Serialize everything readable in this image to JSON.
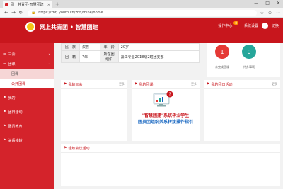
{
  "browser": {
    "tab_title": "网上共青团·智慧团建",
    "tab_close": "×",
    "new_tab": "+",
    "url": "https://zhtj.youth.cn/zhtj/mine/home",
    "window_controls": [
      "—",
      "□",
      "✕"
    ]
  },
  "header": {
    "brand": "网上共青团 • 智慧团建",
    "links": [
      {
        "label": "操作中心",
        "badge": "8"
      },
      {
        "label": "系统设置"
      },
      {
        "label": "切换"
      }
    ]
  },
  "sidebar": {
    "items": [
      {
        "icon": "☰",
        "label": "三会",
        "chev": "⌄"
      },
      {
        "icon": "☰",
        "label": "团课",
        "chev": "⌄"
      },
      {
        "label": "团课",
        "sub": true,
        "active": false
      },
      {
        "label": "公开团课",
        "sub": true,
        "active": true
      },
      {
        "icon": "⚑",
        "label": "我的",
        "chev": ""
      },
      {
        "icon": "⚑",
        "label": "团日活动",
        "chev": ""
      },
      {
        "icon": "⚑",
        "label": "团员教育",
        "chev": ""
      },
      {
        "icon": "⚑",
        "label": "关系接转",
        "chev": ""
      }
    ]
  },
  "info": {
    "rows": [
      {
        "l1": "民　族",
        "v1": "汉族",
        "l2": "年　龄",
        "v2": "20岁"
      },
      {
        "l1": "团　籍",
        "v1": "7年",
        "l2": "所在团组织",
        "v2": "紧工专业2018级2班团支部"
      }
    ]
  },
  "stats": [
    {
      "value": "1",
      "label": "未完成团课"
    },
    {
      "value": "0",
      "label": "待办事项"
    }
  ],
  "panels": {
    "p1": {
      "title": "我的三会",
      "more": "更多"
    },
    "p2": {
      "title": "我的团课",
      "more": "更多",
      "banner1": "\"智慧团建\"系统毕业学生",
      "banner2": "团员团组织关系转接操作指引"
    },
    "p3": {
      "title": "我的团日活动",
      "more": "更多"
    },
    "p4": {
      "title": "组织会议活动"
    }
  },
  "colors": {
    "primary": "#c8161d",
    "sidebar": "#d4232b",
    "accent_green": "#26a69a"
  }
}
